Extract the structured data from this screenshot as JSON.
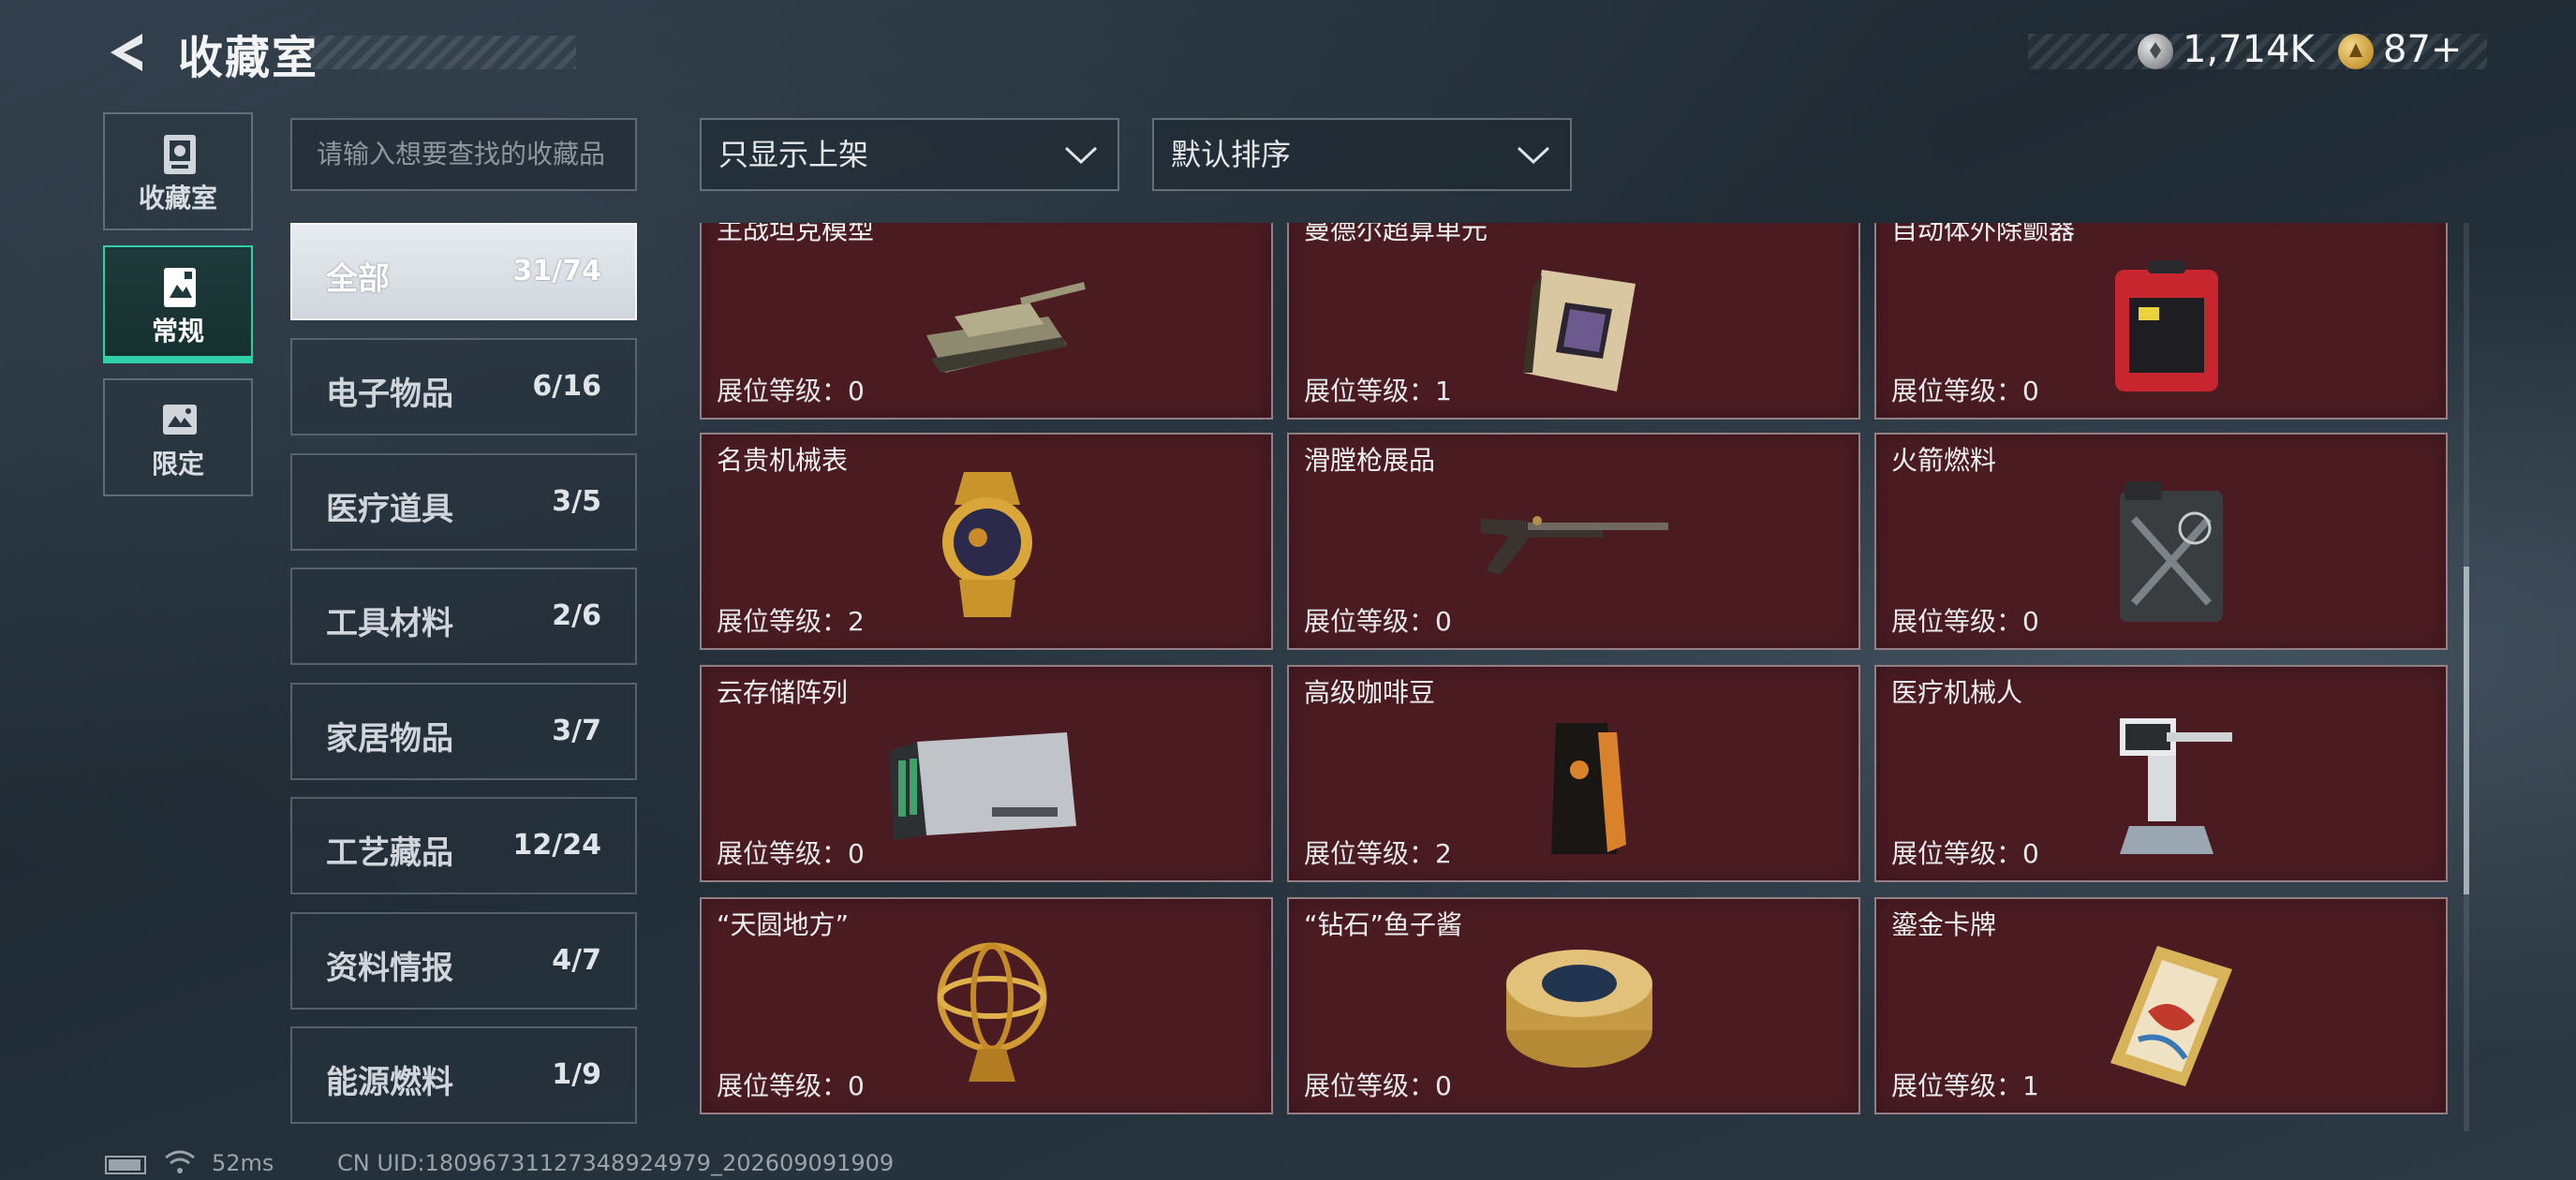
{
  "header": {
    "title": "收藏室",
    "currency": [
      {
        "icon": "silver-coin-icon",
        "value": "1,714K"
      },
      {
        "icon": "gold-coin-icon",
        "value": "87+"
      }
    ]
  },
  "nav": {
    "tabs": [
      {
        "label": "收藏室",
        "icon": "collection-room-icon"
      },
      {
        "label": "常规",
        "icon": "regular-collection-icon",
        "active": true
      },
      {
        "label": "限定",
        "icon": "limited-collection-icon"
      }
    ]
  },
  "search": {
    "placeholder": "请输入想要查找的收藏品"
  },
  "filters": {
    "display": "只显示上架",
    "sort": "默认排序"
  },
  "categories": [
    {
      "name": "全部",
      "count": "31/74",
      "active": true
    },
    {
      "name": "电子物品",
      "count": "6/16"
    },
    {
      "name": "医疗道具",
      "count": "3/5"
    },
    {
      "name": "工具材料",
      "count": "2/6"
    },
    {
      "name": "家居物品",
      "count": "3/7"
    },
    {
      "name": "工艺藏品",
      "count": "12/24"
    },
    {
      "name": "资料情报",
      "count": "4/7"
    },
    {
      "name": "能源燃料",
      "count": "1/9"
    }
  ],
  "items": [
    {
      "name": "主战坦克模型",
      "level": "展位等级：0",
      "icon": "tank-model-icon"
    },
    {
      "name": "曼德尔超算单元",
      "level": "展位等级：1",
      "icon": "supercomputer-unit-icon"
    },
    {
      "name": "自动体外除颤器",
      "level": "展位等级：0",
      "icon": "defibrillator-icon"
    },
    {
      "name": "名贵机械表",
      "level": "展位等级：2",
      "icon": "luxury-watch-icon"
    },
    {
      "name": "滑膛枪展品",
      "level": "展位等级：0",
      "icon": "musket-icon"
    },
    {
      "name": "火箭燃料",
      "level": "展位等级：0",
      "icon": "fuel-canister-icon"
    },
    {
      "name": "云存储阵列",
      "level": "展位等级：0",
      "icon": "storage-array-icon"
    },
    {
      "name": "高级咖啡豆",
      "level": "展位等级：2",
      "icon": "coffee-bag-icon"
    },
    {
      "name": "医疗机械人",
      "level": "展位等级：0",
      "icon": "medical-robot-icon"
    },
    {
      "name": "“天圆地方”",
      "level": "展位等级：0",
      "icon": "armillary-sphere-icon"
    },
    {
      "name": "“钻石”鱼子酱",
      "level": "展位等级：0",
      "icon": "caviar-tin-icon"
    },
    {
      "name": "鎏金卡牌",
      "level": "展位等级：1",
      "icon": "gilded-card-icon"
    }
  ],
  "footer": {
    "ping": "52ms",
    "uid": "CN UID:18096731127348924979_202609091909"
  },
  "colors": {
    "accent": "#2fd0a6",
    "card_bg": "#4a1c22",
    "page_bg": "#25313b"
  }
}
